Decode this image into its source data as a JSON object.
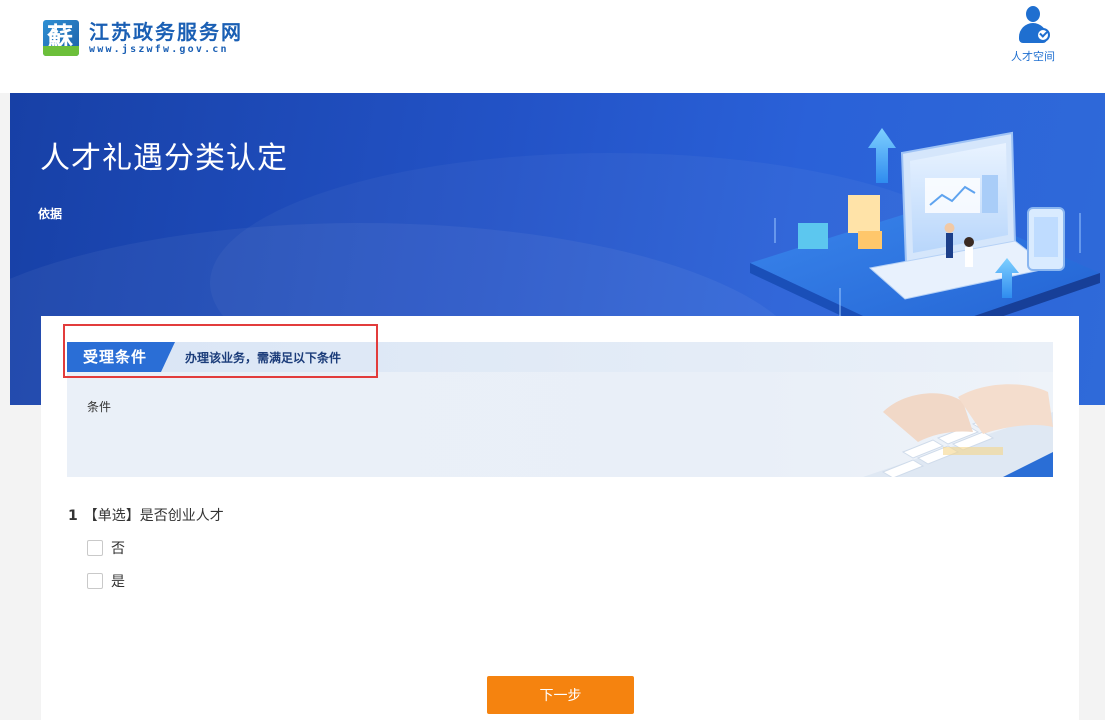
{
  "header": {
    "logo_glyph": "蘇",
    "site_name": "江苏政务服务网",
    "site_url": "www.jszwfw.gov.cn",
    "talent_space_label": "人才空间"
  },
  "banner": {
    "title": "人才礼遇分类认定",
    "basis_label": "依据"
  },
  "conditions": {
    "tab_label": "受理条件",
    "tab_subtitle": "办理该业务，需满足以下条件",
    "content": "条件"
  },
  "question": {
    "number": "1",
    "text": "【单选】是否创业人才",
    "options": [
      {
        "label": "否"
      },
      {
        "label": "是"
      }
    ]
  },
  "actions": {
    "next_label": "下一步"
  },
  "colors": {
    "brand_blue": "#1a5fb4",
    "banner_blue": "#2353c7",
    "tab_blue": "#2a6ed6",
    "next_orange": "#f5830f",
    "highlight_red": "#e23c3c"
  }
}
